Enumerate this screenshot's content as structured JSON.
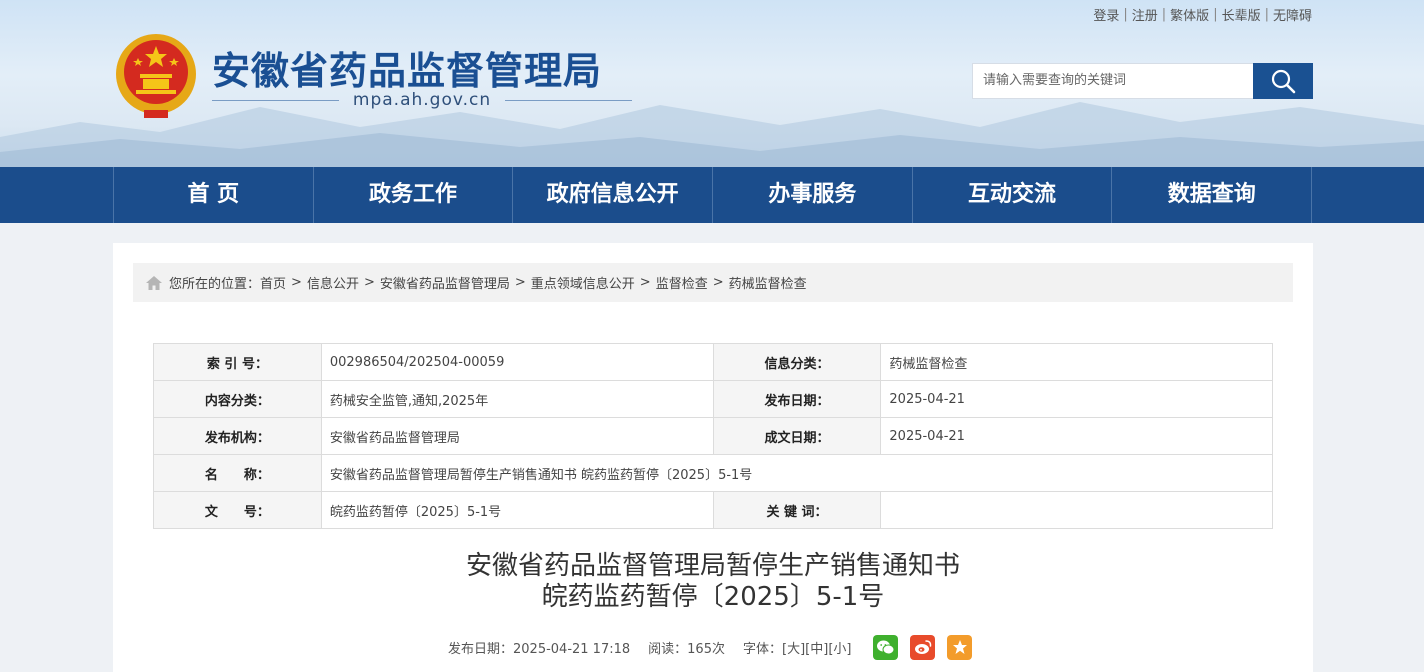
{
  "header": {
    "title": "安徽省药品监督管理局",
    "domain": "mpa.ah.gov.cn",
    "top_links": [
      "登录",
      "注册",
      "繁体版",
      "长辈版",
      "无障碍"
    ],
    "search_placeholder": "请输入需要查询的关键词"
  },
  "nav": [
    "首 页",
    "政务工作",
    "政府信息公开",
    "办事服务",
    "互动交流",
    "数据查询"
  ],
  "breadcrumb": {
    "lead": "您所在的位置：",
    "items": [
      "首页",
      "信息公开",
      "安徽省药品监督管理局",
      "重点领域信息公开",
      "监督检查",
      "药械监督检查"
    ],
    "sep": ">"
  },
  "meta": {
    "index_label": "索 引 号：",
    "index_value": "002986504/202504-00059",
    "info_cat_label": "信息分类：",
    "info_cat_value": "药械监督检查",
    "content_cat_label": "内容分类：",
    "content_cat_value": "药械安全监管,通知,2025年",
    "pub_date_label": "发布日期：",
    "pub_date_value": "2025-04-21",
    "org_label": "发布机构：",
    "org_value": "安徽省药品监督管理局",
    "made_date_label": "成文日期：",
    "made_date_value": "2025-04-21",
    "name_label": "名　　称：",
    "name_value": "安徽省药品监督管理局暂停生产销售通知书 皖药监药暂停〔2025〕5-1号",
    "docno_label": "文　　号：",
    "docno_value": "皖药监药暂停〔2025〕5-1号",
    "keywords_label": "关 键 词：",
    "keywords_value": ""
  },
  "article": {
    "title_line1": "安徽省药品监督管理局暂停生产销售通知书",
    "title_line2": "皖药监药暂停〔2025〕5-1号",
    "pub_date": "发布日期：2025-04-21 17:18",
    "reads": "阅读：165次",
    "font_label": "字体：",
    "font_large": "[大]",
    "font_medium": "[中]",
    "font_small": "[小]"
  }
}
